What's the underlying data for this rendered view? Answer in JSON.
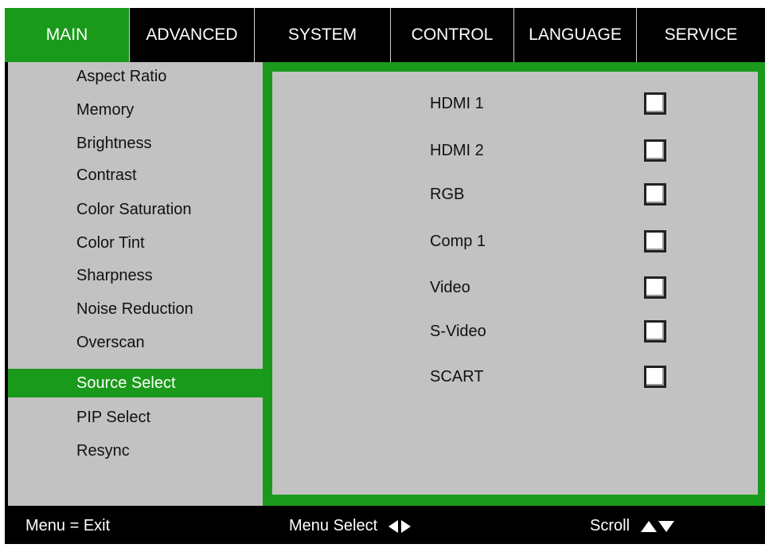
{
  "tabs": [
    {
      "label": "MAIN",
      "active": true
    },
    {
      "label": "ADVANCED",
      "active": false
    },
    {
      "label": "SYSTEM",
      "active": false
    },
    {
      "label": "CONTROL",
      "active": false
    },
    {
      "label": "LANGUAGE",
      "active": false
    },
    {
      "label": "SERVICE",
      "active": false
    }
  ],
  "menu": {
    "items": [
      {
        "label": "Aspect Ratio"
      },
      {
        "label": "Memory"
      },
      {
        "label": "Brightness"
      },
      {
        "label": "Contrast"
      },
      {
        "label": "Color Saturation"
      },
      {
        "label": "Color Tint"
      },
      {
        "label": "Sharpness"
      },
      {
        "label": "Noise Reduction"
      },
      {
        "label": "Overscan"
      },
      {
        "label": "Source Select",
        "selected": true
      },
      {
        "label": "PIP Select"
      },
      {
        "label": "Resync"
      }
    ]
  },
  "sources": [
    {
      "label": "HDMI 1",
      "checked": false
    },
    {
      "label": "HDMI 2",
      "checked": false
    },
    {
      "label": "RGB",
      "checked": false
    },
    {
      "label": "Comp 1",
      "checked": false
    },
    {
      "label": "Video",
      "checked": false
    },
    {
      "label": "S-Video",
      "checked": false
    },
    {
      "label": "SCART",
      "checked": false
    }
  ],
  "footer": {
    "exit_hint": "Menu = Exit",
    "select_hint": "Menu Select",
    "scroll_hint": "Scroll",
    "icons": [
      "arrow-left-icon",
      "arrow-right-icon",
      "arrow-up-icon",
      "arrow-down-icon"
    ]
  },
  "colors": {
    "accent": "#1a9a1a",
    "panel_bg": "#c2c2c2",
    "frame": "#000000"
  }
}
